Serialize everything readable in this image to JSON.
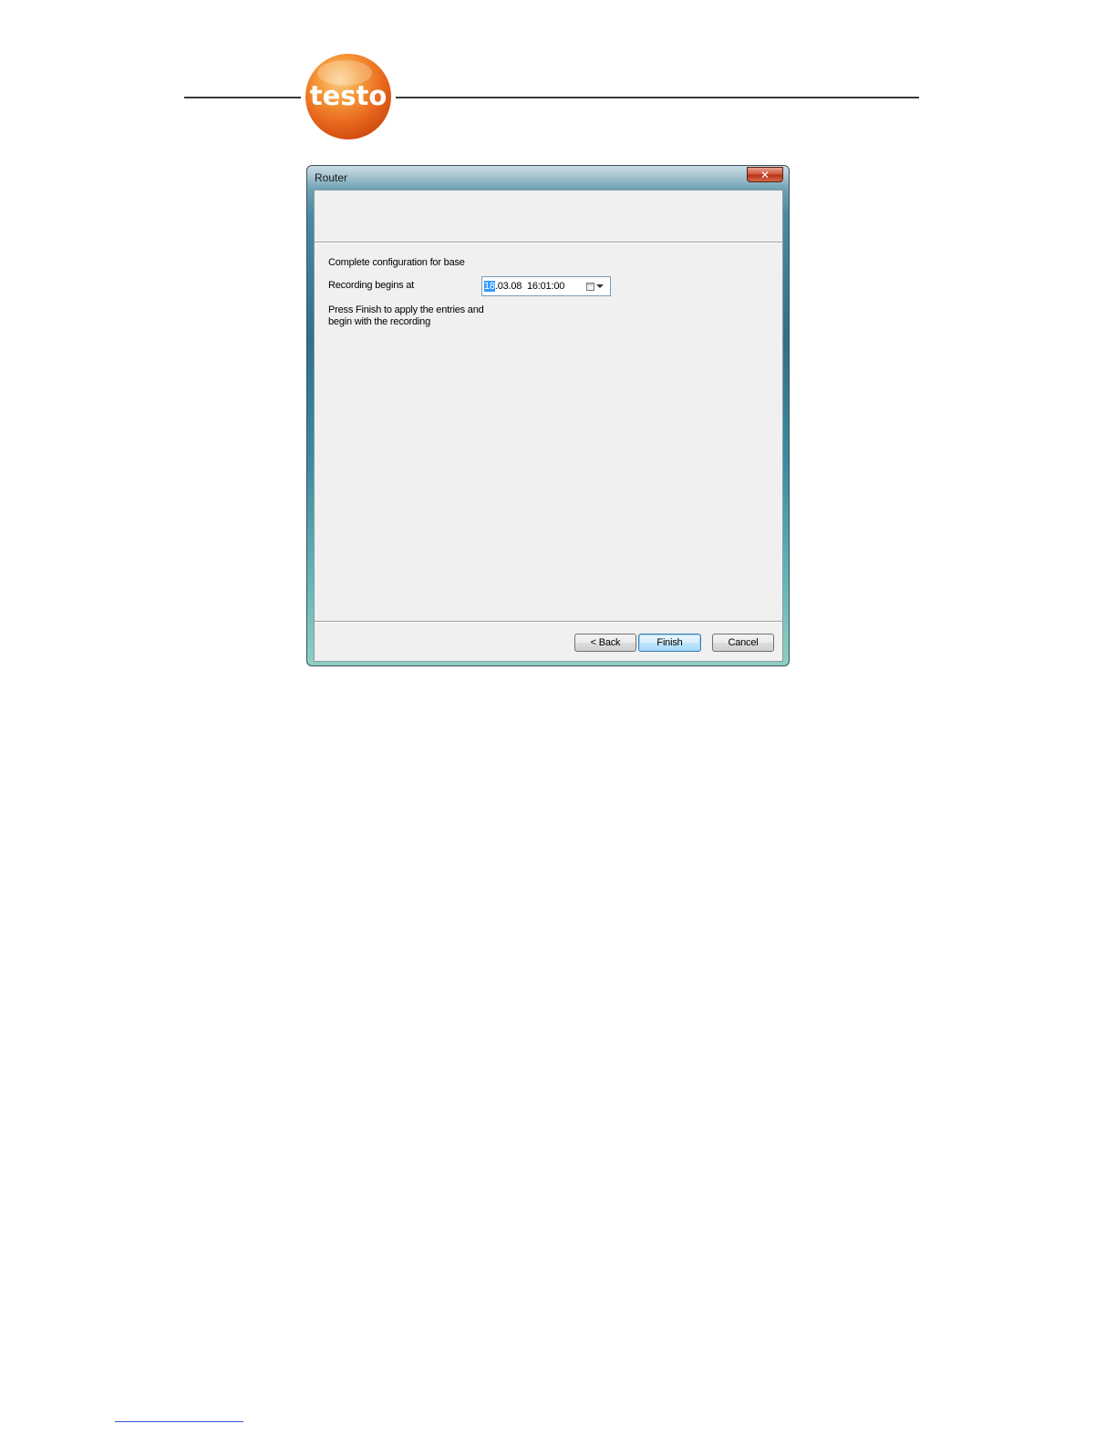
{
  "brand": {
    "logo_text": "testo",
    "logo_color": "#f07a1e"
  },
  "dialog": {
    "title": "Router",
    "close_icon": "close-icon",
    "section_heading": "Complete configuration for base",
    "recording_label": "Recording begins at",
    "datetime": {
      "day_selected": "18",
      "rest": ".03.08  16:01:00",
      "icon": "calendar-icon"
    },
    "instructions": "Press Finish to apply the entries and begin with the recording",
    "buttons": {
      "back": "< Back",
      "finish": "Finish",
      "cancel": "Cancel"
    }
  },
  "colors": {
    "selection": "#3399ff",
    "client_background": "#f0f0f0",
    "window_frame": "#2f7288"
  }
}
